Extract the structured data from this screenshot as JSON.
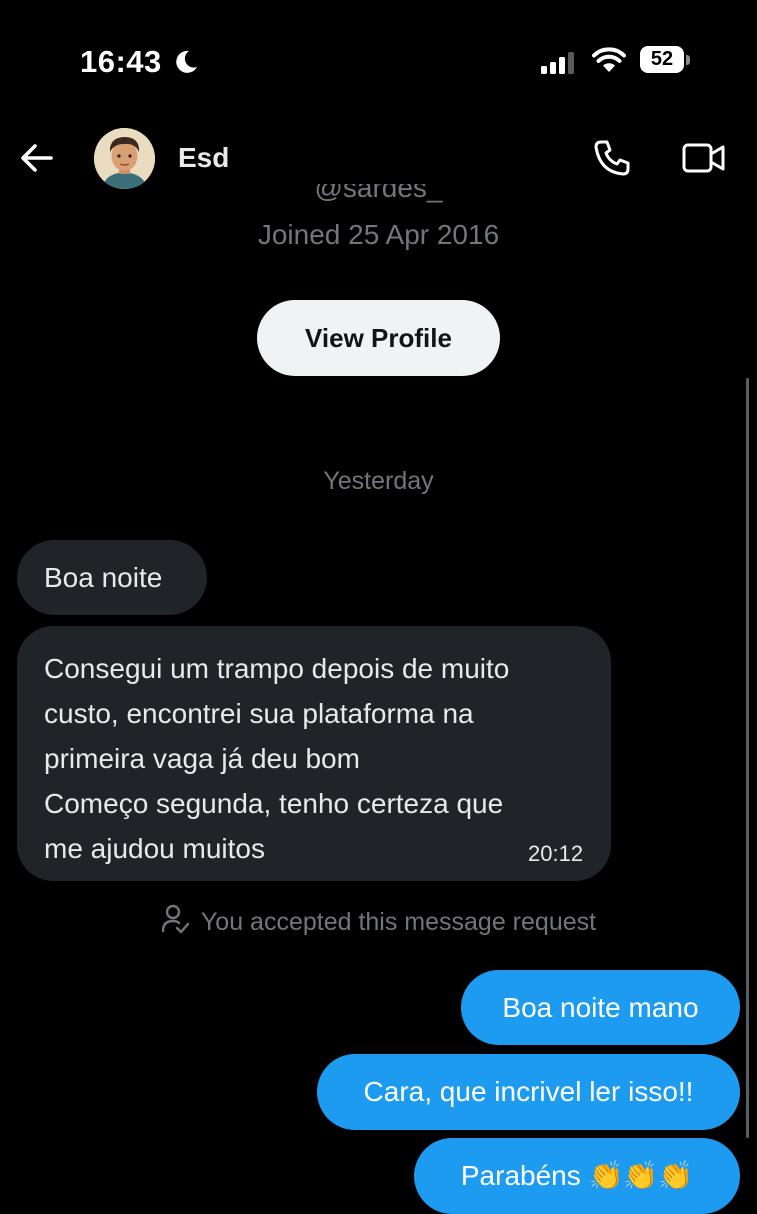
{
  "status_bar": {
    "time": "16:43",
    "battery": "52",
    "moon_icon": "moon-icon",
    "signal_icon": "cellular-signal-icon",
    "wifi_icon": "wifi-icon"
  },
  "header": {
    "back_icon": "arrow-left-icon",
    "username": "Esd",
    "call_icon": "phone-icon",
    "video_icon": "video-camera-icon"
  },
  "profile": {
    "handle": "@sardes_",
    "joined": "Joined 25 Apr 2016",
    "view_profile_label": "View Profile"
  },
  "conversation": {
    "date_divider": "Yesterday",
    "received": [
      {
        "text": "Boa noite"
      },
      {
        "text": "Consegui um trampo depois de muito\ncusto, encontrei sua plataforma na\nprimeira vaga já deu bom\nComeço segunda, tenho certeza que\nme ajudou muitos",
        "time": "20:12"
      }
    ],
    "system_notice": "You accepted this message request",
    "sent": [
      {
        "text": "Boa noite mano"
      },
      {
        "text": "Cara, que incrivel ler isso!!"
      },
      {
        "text": "Parabéns 👏👏👏"
      }
    ]
  },
  "colors": {
    "background": "#000000",
    "received_bubble": "#202327",
    "sent_bubble": "#1d9bf0",
    "muted_text": "#71767b",
    "button_bg": "#eff3f4"
  }
}
